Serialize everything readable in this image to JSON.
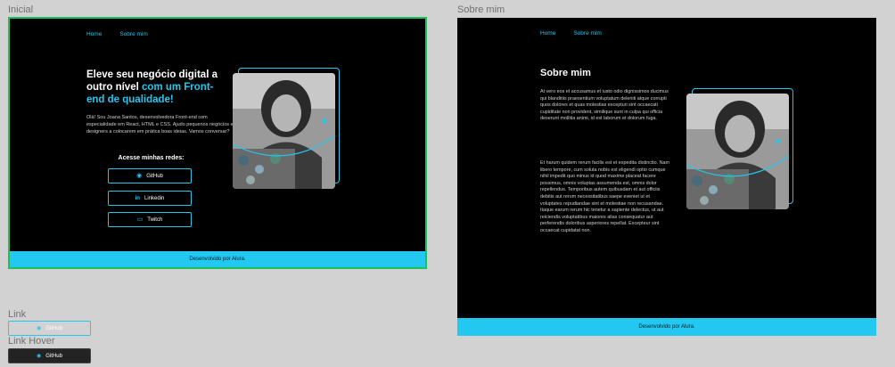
{
  "frames": {
    "inicial": "Inicial",
    "sobre": "Sobre mim",
    "link": "Link",
    "link_hover": "Link Hover"
  },
  "nav": {
    "home": "Home",
    "about": "Sobre mim"
  },
  "hero": {
    "title_part1": "Eleve seu negócio digital a outro nível ",
    "title_accent": "com um Front-end de qualidade!",
    "description": "Olá! Sou Joana Santos, desenvolvedora Front-end com especialidade em React, HTML e CSS. Ajudo pequenos negócios e designers a colocarem em prática boas ideias. Vamos conversar?",
    "networks_title": "Acesse minhas redes:"
  },
  "buttons": [
    {
      "label": "GitHub",
      "icon": "github-icon"
    },
    {
      "label": "Linkedin",
      "icon": "linkedin-icon"
    },
    {
      "label": "Twitch",
      "icon": "twitch-icon"
    }
  ],
  "about": {
    "title": "Sobre mim",
    "paragraph1": "At vero eos et accusamus et iusto odio dignissimos ducimus qui blanditiis praesentium voluptatum deleniti atque corrupti quos dolores et quas molestias excepturi sint occaecati cupiditate non provident, similique sunt in culpa qui officia deserunt mollitia animi, id est laborum et dolorum fuga.",
    "paragraph2": "Et harum quidem rerum facilis est et expedita distinctio. Nam libero tempore, cum soluta nobis est eligendi optio cumque nihil impedit quo minus id quod maxime placeat facere possimus, omnis voluptas assumenda est, omnis dolor repellendus. Temporibus autem quibusdam et aut officiis debitis aut rerum necessitatibus saepe eveniet ut et voluptates repudiandae sint et molestiae non recusandae. Itaque earum rerum hic tenetur a sapiente delectus, ut aut reiciendis voluptatibus maiores alias consequatur aut perferendis doloribus asperiores repellat. Excepteur sint occaecat cupidatat non."
  },
  "footer": "Desenvolvido por Alura.",
  "states": {
    "link_label": "GitHub",
    "hover_label": "GitHub"
  },
  "colors": {
    "accent": "#23c8f0",
    "background": "#000000",
    "selected_frame": "#1fbf5b"
  }
}
